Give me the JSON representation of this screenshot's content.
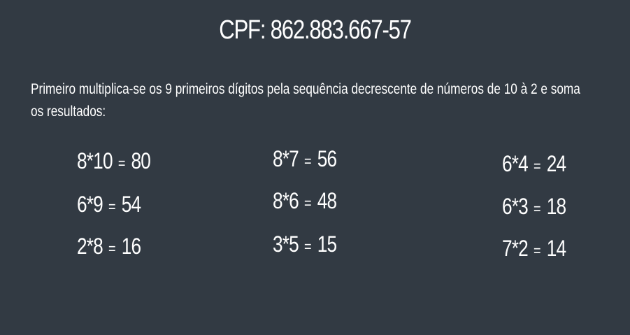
{
  "slide": {
    "title": "CPF: 862.883.667-57",
    "intro": "Primeiro multiplica-se os 9 primeiros dígitos pela sequência decrescente de números de 10 à 2 e soma os resultados:",
    "columns": [
      [
        {
          "left": "8*10",
          "eq": "=",
          "right": "80"
        },
        {
          "left": "6*9",
          "eq": "=",
          "right": "54"
        },
        {
          "left": "2*8",
          "eq": "=",
          "right": "16"
        }
      ],
      [
        {
          "left": "8*7",
          "eq": "=",
          "right": "56"
        },
        {
          "left": "8*6",
          "eq": "=",
          "right": "48"
        },
        {
          "left": "3*5",
          "eq": "=",
          "right": "15"
        }
      ],
      [
        {
          "left": "6*4",
          "eq": "=",
          "right": "24"
        },
        {
          "left": "6*3",
          "eq": "=",
          "right": "18"
        },
        {
          "left": "7*2",
          "eq": "=",
          "right": "14"
        }
      ]
    ]
  }
}
